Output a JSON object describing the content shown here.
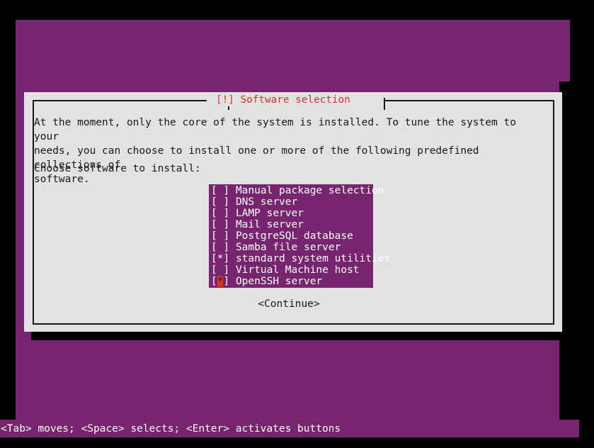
{
  "screen": {
    "background_color": "#76256e",
    "frame_color": "#000000"
  },
  "dialog": {
    "title": "[!] Software selection",
    "title_color": "#d8341c",
    "background_color": "#e4e1e4",
    "border_color": "#1a1a1a",
    "body_text": "At the moment, only the core of the system is installed. To tune the system to your\nneeds, you can choose to install one or more of the following predefined collections of\nsoftware.",
    "prompt": "Choose software to install:",
    "listbox": {
      "background_color": "#76256e",
      "text_color": "#ffffff",
      "cursor_color": "#d8341c",
      "items": [
        {
          "checkbox": "[ ]",
          "label": "Manual package selection",
          "checked": false,
          "cursor": false
        },
        {
          "checkbox": "[ ]",
          "label": "DNS server",
          "checked": false,
          "cursor": false
        },
        {
          "checkbox": "[ ]",
          "label": "LAMP server",
          "checked": false,
          "cursor": false
        },
        {
          "checkbox": "[ ]",
          "label": "Mail server",
          "checked": false,
          "cursor": false
        },
        {
          "checkbox": "[ ]",
          "label": "PostgreSQL database",
          "checked": false,
          "cursor": false
        },
        {
          "checkbox": "[ ]",
          "label": "Samba file server",
          "checked": false,
          "cursor": false
        },
        {
          "checkbox": "[*]",
          "label": "standard system utilities",
          "checked": true,
          "cursor": false
        },
        {
          "checkbox": "[ ]",
          "label": "Virtual Machine host",
          "checked": false,
          "cursor": false
        },
        {
          "checkbox": "[*]",
          "label": "OpenSSH server",
          "checked": true,
          "cursor": true
        }
      ]
    },
    "continue_button": "<Continue>"
  },
  "footer": {
    "help_text": "<Tab> moves; <Space> selects; <Enter> activates buttons"
  }
}
